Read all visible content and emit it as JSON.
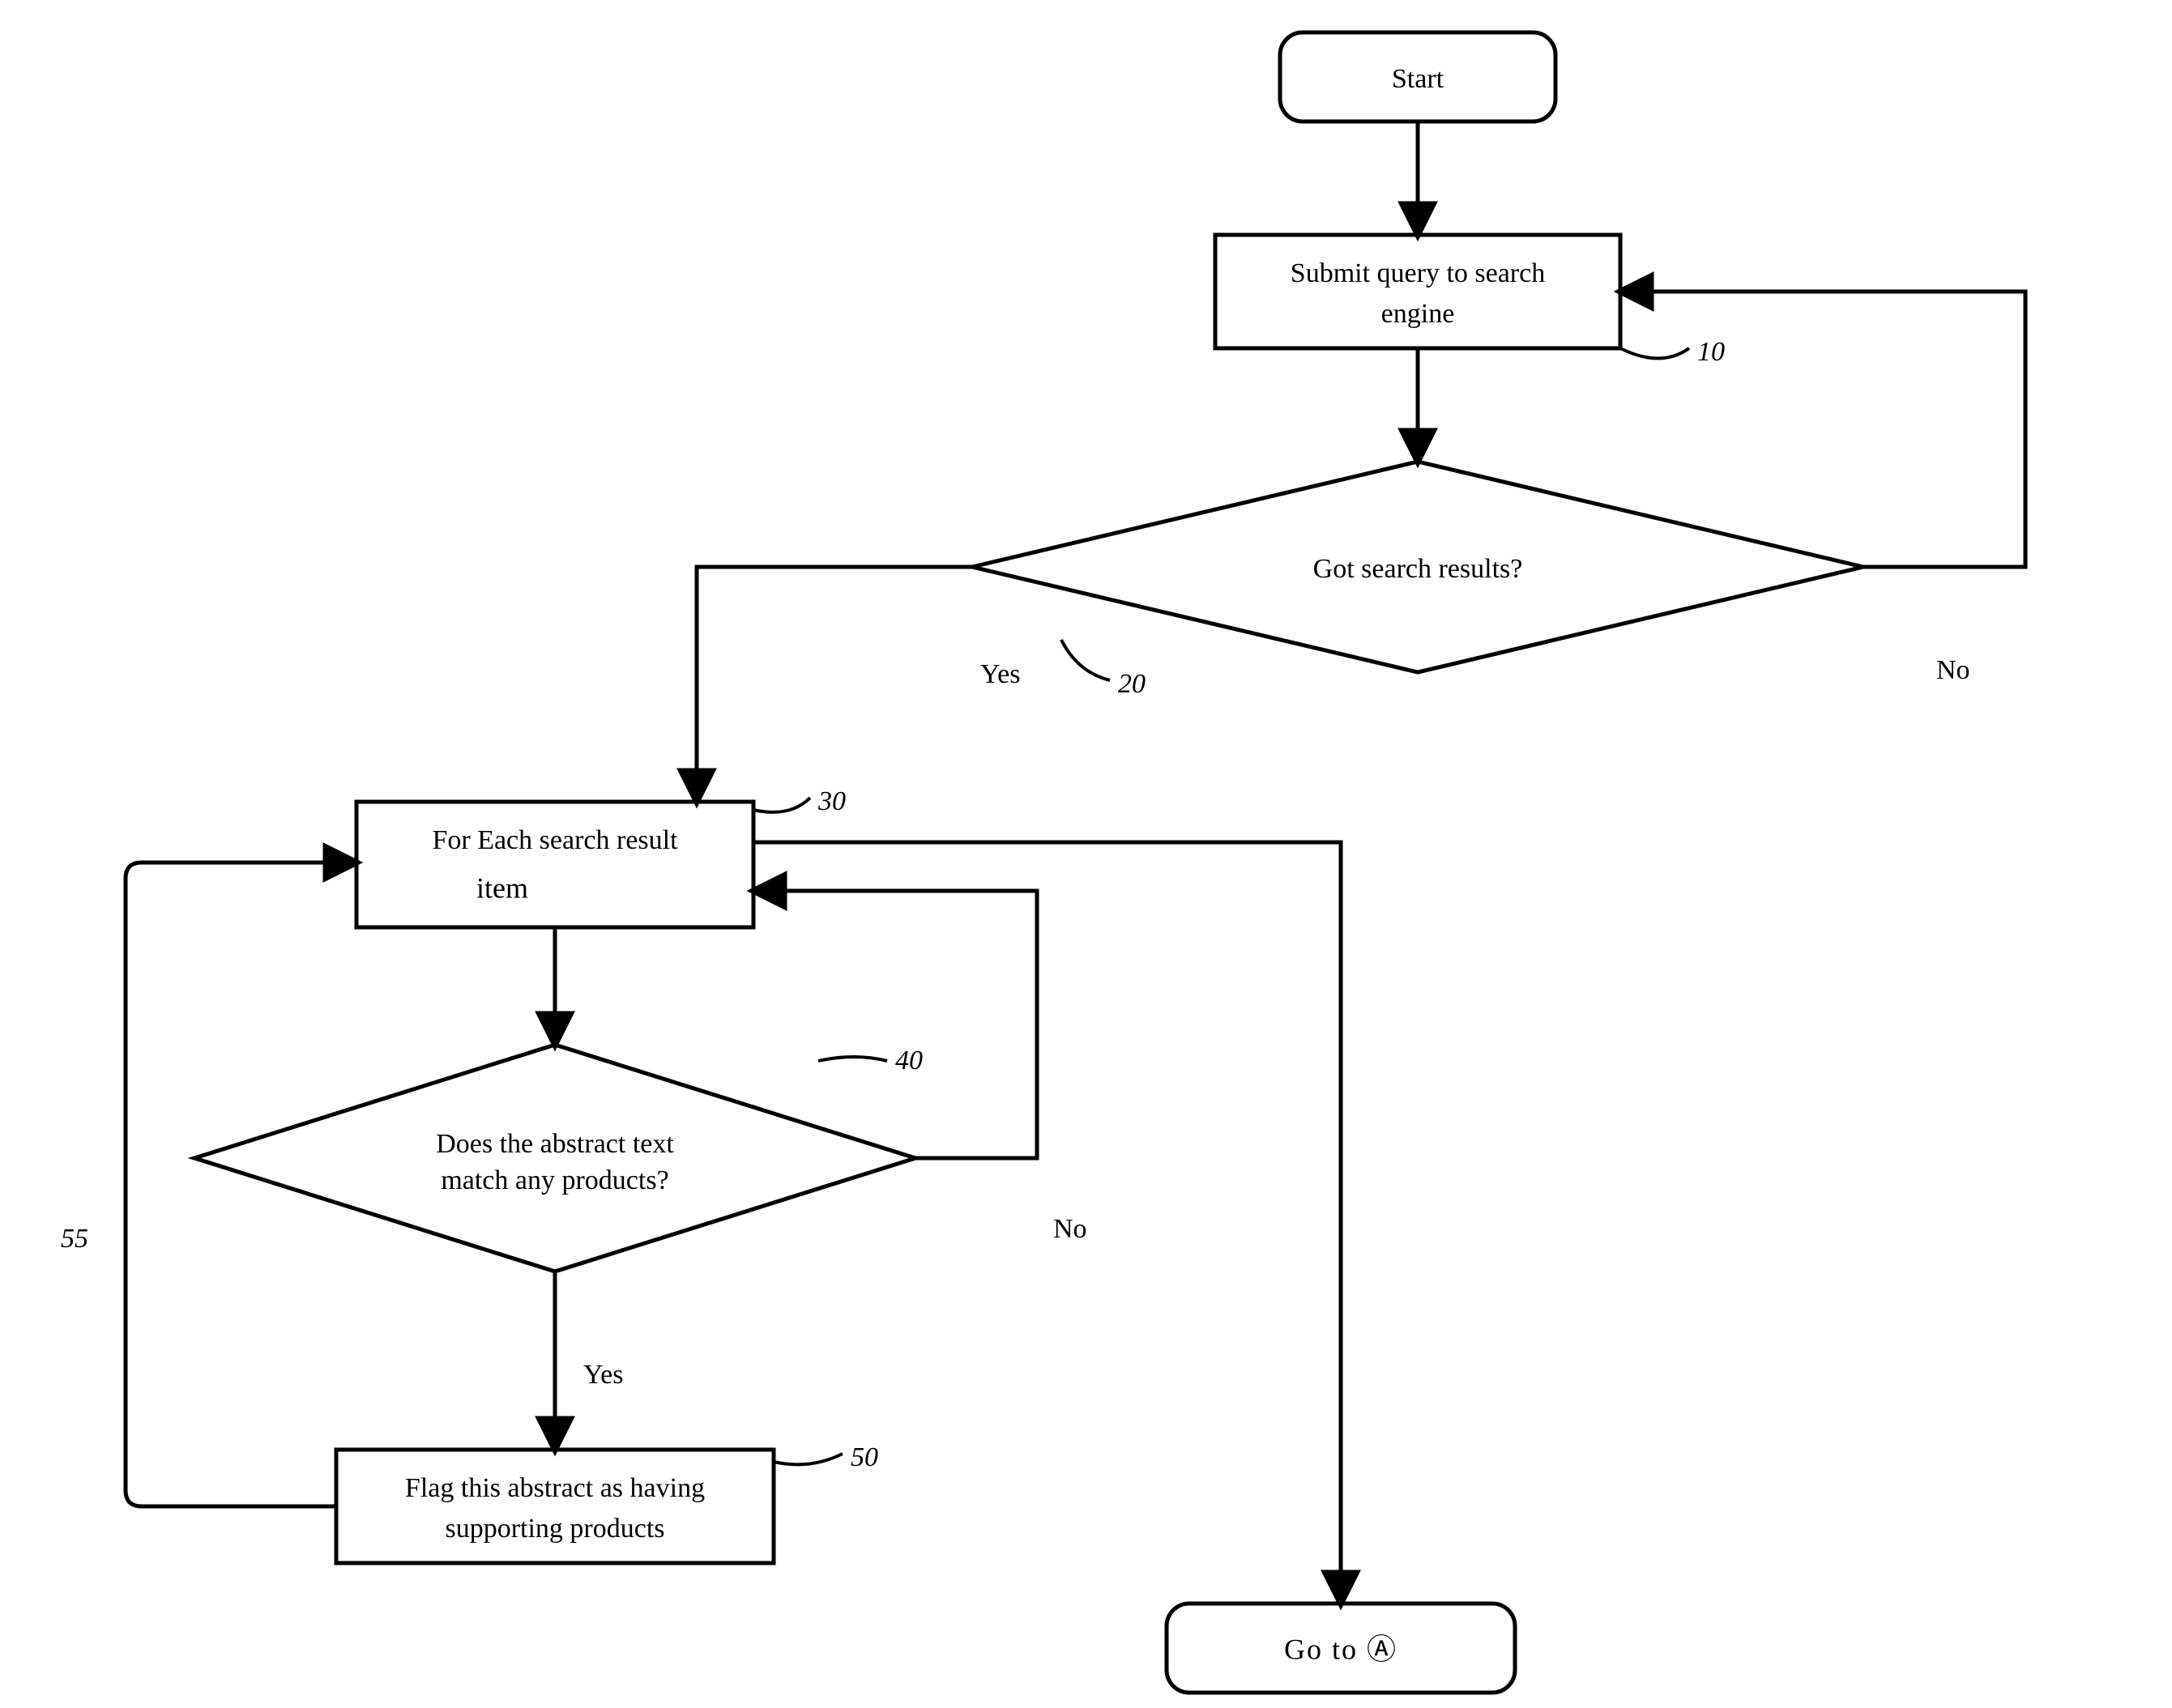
{
  "nodes": {
    "start": {
      "label": "Start"
    },
    "submit": {
      "label_l1": "Submit query to search",
      "label_l2": "engine",
      "ref": "10"
    },
    "gotResults": {
      "label": "Got search results?",
      "ref": "20",
      "yes": "Yes",
      "no": "No"
    },
    "forEach": {
      "label_l1": "For Each search result",
      "label_l2": "item",
      "ref": "30"
    },
    "abstractMatch": {
      "label_l1": "Does the abstract  text",
      "label_l2": "match any products?",
      "ref": "40",
      "yes": "Yes",
      "no": "No"
    },
    "flag": {
      "label_l1": "Flag this abstract as having",
      "label_l2": "supporting products",
      "ref": "50"
    },
    "loopRef": "55",
    "gotoA": {
      "label": "Go to Ⓐ"
    }
  }
}
